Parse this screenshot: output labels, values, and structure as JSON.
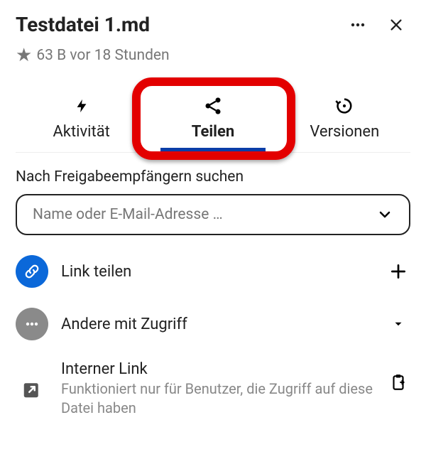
{
  "header": {
    "title": "Testdatei 1.md",
    "meta": "63 B vor 18 Stunden"
  },
  "tabs": {
    "activity": "Aktivität",
    "share": "Teilen",
    "versions": "Versionen"
  },
  "share": {
    "search_label": "Nach Freigabeempfängern suchen",
    "search_placeholder": "Name oder E-Mail-Adresse …",
    "link_share": "Link teilen",
    "others_access": "Andere mit Zugriff",
    "internal_title": "Interner Link",
    "internal_sub": "Funktioniert nur für Benutzer, die Zugriff auf diese Datei haben"
  }
}
